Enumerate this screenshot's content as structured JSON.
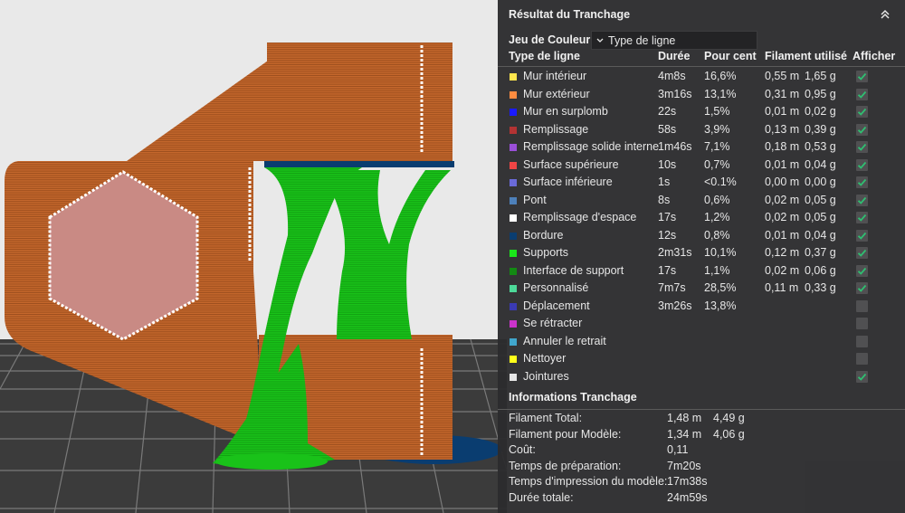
{
  "panel": {
    "title": "Résultat du Tranchage",
    "color_scheme_label": "Jeu de Couleur",
    "color_scheme_value": "Type de ligne",
    "headers": {
      "type": "Type de ligne",
      "duration": "Durée",
      "percent": "Pour cent",
      "filament": "Filament utilisé",
      "show": "Afficher"
    },
    "rows": [
      {
        "name": "Mur intérieur",
        "color": "#ffe64d",
        "duration": "4m8s",
        "percent": "16,6%",
        "fil_m": "0,55 m",
        "fil_g": "1,65 g",
        "shown": true
      },
      {
        "name": "Mur extérieur",
        "color": "#ff8c40",
        "duration": "3m16s",
        "percent": "13,1%",
        "fil_m": "0,31 m",
        "fil_g": "0,95 g",
        "shown": true
      },
      {
        "name": "Mur en surplomb",
        "color": "#1a1aff",
        "duration": "22s",
        "percent": "1,5%",
        "fil_m": "0,01 m",
        "fil_g": "0,02 g",
        "shown": true
      },
      {
        "name": "Remplissage",
        "color": "#b33333",
        "duration": "58s",
        "percent": "3,9%",
        "fil_m": "0,13 m",
        "fil_g": "0,39 g",
        "shown": true
      },
      {
        "name": "Remplissage solide interne",
        "color": "#9a4fd9",
        "duration": "1m46s",
        "percent": "7,1%",
        "fil_m": "0,18 m",
        "fil_g": "0,53 g",
        "shown": true
      },
      {
        "name": "Surface supérieure",
        "color": "#f04545",
        "duration": "10s",
        "percent": "0,7%",
        "fil_m": "0,01 m",
        "fil_g": "0,04 g",
        "shown": true
      },
      {
        "name": "Surface inférieure",
        "color": "#6a6ad9",
        "duration": "1s",
        "percent": "<0.1%",
        "fil_m": "0,00 m",
        "fil_g": "0,00 g",
        "shown": true
      },
      {
        "name": "Pont",
        "color": "#4d80ba",
        "duration": "8s",
        "percent": "0,6%",
        "fil_m": "0,02 m",
        "fil_g": "0,05 g",
        "shown": true
      },
      {
        "name": "Remplissage d'espace",
        "color": "#ffffff",
        "duration": "17s",
        "percent": "1,2%",
        "fil_m": "0,02 m",
        "fil_g": "0,05 g",
        "shown": true
      },
      {
        "name": "Bordure",
        "color": "#0a3d70",
        "duration": "12s",
        "percent": "0,8%",
        "fil_m": "0,01 m",
        "fil_g": "0,04 g",
        "shown": true
      },
      {
        "name": "Supports",
        "color": "#1ae61a",
        "duration": "2m31s",
        "percent": "10,1%",
        "fil_m": "0,12 m",
        "fil_g": "0,37 g",
        "shown": true
      },
      {
        "name": "Interface de support",
        "color": "#138a13",
        "duration": "17s",
        "percent": "1,1%",
        "fil_m": "0,02 m",
        "fil_g": "0,06 g",
        "shown": true
      },
      {
        "name": "Personnalisé",
        "color": "#4dd999",
        "duration": "7m7s",
        "percent": "28,5%",
        "fil_m": "0,11 m",
        "fil_g": "0,33 g",
        "shown": true
      },
      {
        "name": "Déplacement",
        "color": "#3a3ab3",
        "duration": "3m26s",
        "percent": "13,8%",
        "fil_m": "",
        "fil_g": "",
        "shown": false
      },
      {
        "name": "Se rétracter",
        "color": "#cc33cc",
        "duration": "",
        "percent": "",
        "fil_m": "",
        "fil_g": "",
        "shown": false
      },
      {
        "name": "Annuler le retrait",
        "color": "#40a6cc",
        "duration": "",
        "percent": "",
        "fil_m": "",
        "fil_g": "",
        "shown": false
      },
      {
        "name": "Nettoyer",
        "color": "#ffff1a",
        "duration": "",
        "percent": "",
        "fil_m": "",
        "fil_g": "",
        "shown": false
      },
      {
        "name": "Jointures",
        "color": "#e6e6e6",
        "duration": "",
        "percent": "",
        "fil_m": "",
        "fil_g": "",
        "shown": true
      }
    ],
    "info_title": "Informations Tranchage",
    "info_rows": [
      {
        "label": "Filament Total:",
        "v1": "1,48 m",
        "v2": "4,49 g"
      },
      {
        "label": "Filament pour Modèle:",
        "v1": "1,34 m",
        "v2": "4,06 g"
      },
      {
        "label": "Coût:",
        "v1": "0,11",
        "v2": ""
      },
      {
        "label": "Temps de préparation:",
        "v1": "7m20s",
        "v2": ""
      },
      {
        "label": "Temps d'impression du modèle:",
        "v1": "17m38s",
        "v2": ""
      },
      {
        "label": "Durée totale:",
        "v1": "24m59s",
        "v2": ""
      }
    ]
  },
  "colors": {
    "panel_bg": "#2c2c2e",
    "check_green": "#2fbf71",
    "model_orange": "#c4672c",
    "support_green": "#19c219"
  },
  "icons": {
    "collapse": "chevron-up-double-icon",
    "dropdown": "chevron-down-icon",
    "check": "checkmark-icon"
  }
}
